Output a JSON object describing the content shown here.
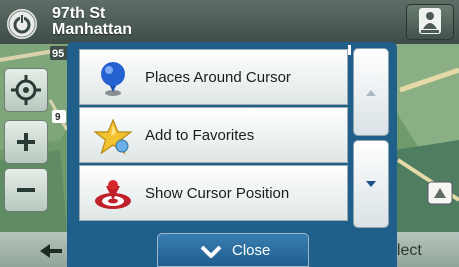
{
  "top_bar": {
    "street_line1": "97th St",
    "street_line2": "Manhattan",
    "logo_icon": "back-logo-icon",
    "person_icon": "person-icon"
  },
  "map": {
    "road_label_95": "95",
    "road_label_9": "9"
  },
  "side_controls": [
    {
      "icon": "locate-crosshair-icon"
    },
    {
      "icon": "zoom-in-icon"
    },
    {
      "icon": "zoom-out-icon"
    }
  ],
  "menu": {
    "items": [
      {
        "label": "Places Around Cursor",
        "icon": "blue-pin-icon"
      },
      {
        "label": "Add to Favorites",
        "icon": "star-icon"
      },
      {
        "label": "Show Cursor Position",
        "icon": "target-icon"
      }
    ],
    "scroll_up_icon": "scroll-up-icon",
    "scroll_down_icon": "scroll-down-icon",
    "close_label": "Close",
    "close_icon": "chevron-down-icon"
  },
  "bottom_bar": {
    "select_label": "elect",
    "back_icon": "arrow-left-icon"
  },
  "colors": {
    "popup_blue": "#1f5f8a",
    "close_button_blue": "#2c6f9f",
    "map_green": "#6e9a6a",
    "menu_item_bg": "#f4f6f5"
  }
}
